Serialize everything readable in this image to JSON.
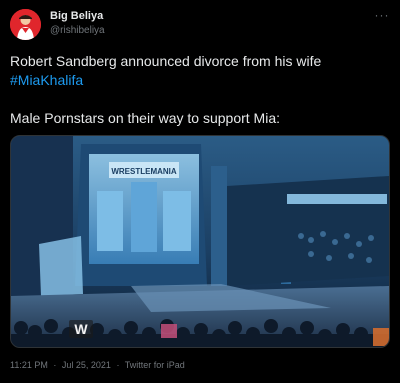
{
  "author": {
    "display_name": "Big Beliya",
    "handle": "@rishibeliya",
    "avatar_color": "#e0262c"
  },
  "more_icon": "more-horizontal-icon",
  "more_label": "···",
  "tweet": {
    "line1": "Robert Sandberg announced divorce from his wife",
    "hashtag": "#MiaKhalifa",
    "line3": "Male Pornstars on their way to support Mia:"
  },
  "media": {
    "description_icon": "video-thumbnail",
    "stage_sign": "WRESTLEMANIA",
    "logo": "W"
  },
  "meta": {
    "time": "11:21 PM",
    "separator": "·",
    "date": "Jul 25, 2021",
    "source": "Twitter for iPad"
  },
  "colors": {
    "background": "#000000",
    "text": "#e7e9ea",
    "secondary": "#71767b",
    "link": "#1d9bf0"
  }
}
